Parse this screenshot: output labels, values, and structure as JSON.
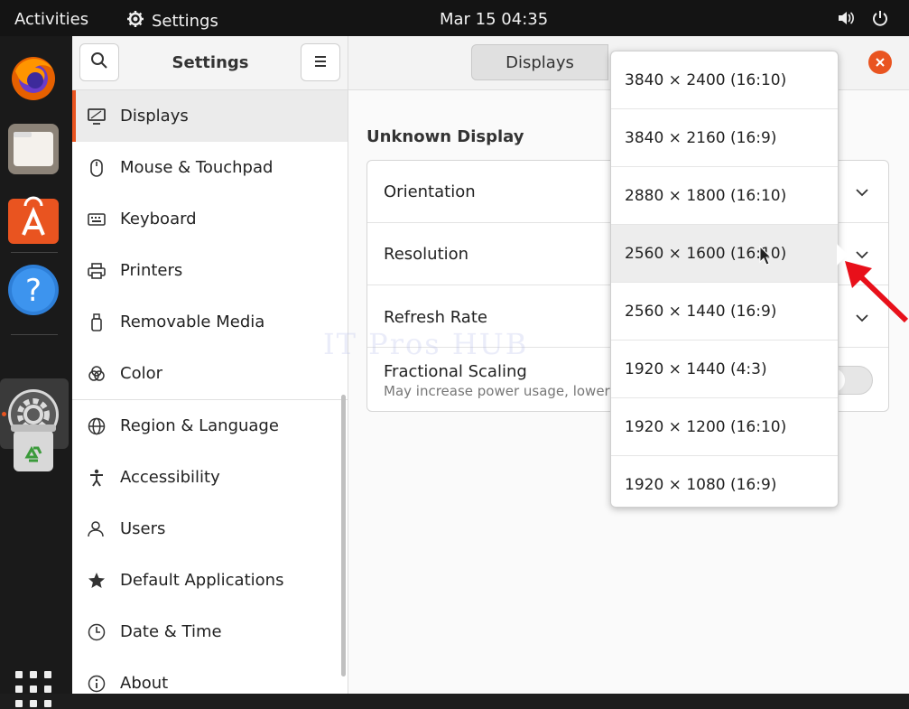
{
  "topbar": {
    "activities": "Activities",
    "app_name": "Settings",
    "clock": "Mar 15  04:35",
    "icons": [
      "settings-gear-icon",
      "volume-icon",
      "power-icon"
    ]
  },
  "dock": {
    "apps": [
      "firefox",
      "files",
      "software-center",
      "help",
      "settings",
      "trash"
    ],
    "grid_icon": "show-apps-icon"
  },
  "sidebar": {
    "title": "Settings",
    "items": [
      {
        "label": "Displays",
        "icon": "display-icon",
        "active": true
      },
      {
        "label": "Mouse & Touchpad",
        "icon": "mouse-icon"
      },
      {
        "label": "Keyboard",
        "icon": "keyboard-icon"
      },
      {
        "label": "Printers",
        "icon": "printer-icon"
      },
      {
        "label": "Removable Media",
        "icon": "removable-media-icon"
      },
      {
        "label": "Color",
        "icon": "color-icon"
      },
      {
        "label": "Region & Language",
        "icon": "globe-icon"
      },
      {
        "label": "Accessibility",
        "icon": "accessibility-icon"
      },
      {
        "label": "Users",
        "icon": "users-icon"
      },
      {
        "label": "Default Applications",
        "icon": "star-icon"
      },
      {
        "label": "Date & Time",
        "icon": "clock-icon"
      },
      {
        "label": "About",
        "icon": "info-icon"
      }
    ]
  },
  "main": {
    "tab_displays": "Displays",
    "section_title": "Unknown Display",
    "rows": {
      "orientation": "Orientation",
      "resolution": "Resolution",
      "refresh_rate": "Refresh Rate",
      "fractional_scaling": "Fractional Scaling",
      "fractional_scaling_sub": "May increase power usage, lower spe"
    },
    "watermark": "IT Pros HUB"
  },
  "resolution_popover": {
    "options": [
      "3840 × 2400 (16:10)",
      "3840 × 2160 (16:9)",
      "2880 × 1800 (16:10)",
      "2560 × 1600 (16:10)",
      "2560 × 1440 (16:9)",
      "1920 × 1440 (4:3)",
      "1920 × 1200 (16:10)",
      "1920 × 1080 (16:9)"
    ],
    "hovered_index": 3
  },
  "colors": {
    "accent": "#e95420",
    "annotation_arrow": "#e8101a"
  }
}
